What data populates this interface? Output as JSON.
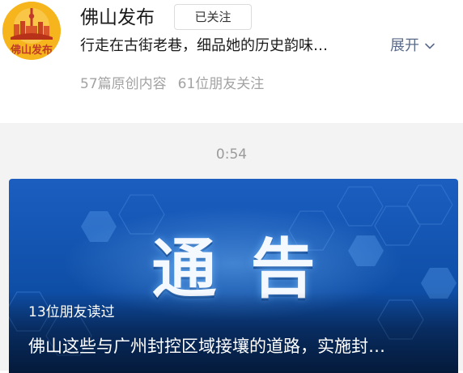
{
  "account": {
    "name": "佛山发布",
    "follow_label": "已关注",
    "intro": "行走在古街老巷，细品她的历史韵味…",
    "expand_label": "展开",
    "original_count": "57篇原创内容",
    "friends_following": "61位朋友关注",
    "avatar_text": "佛山发布"
  },
  "feed": {
    "timestamp": "0:54",
    "article": {
      "cover_title": "通告",
      "readers": "13位朋友读过",
      "title": "佛山这些与广州封控区域接壤的道路，实施封…"
    }
  },
  "colors": {
    "avatar_bg": "#f6b51d",
    "link": "#5a6b8a",
    "muted": "#a3a3a3",
    "feed_bg": "#f3f3f3",
    "cover_blue": "#0f4fa8"
  },
  "icons": {
    "expand": "chevron-down-icon"
  }
}
